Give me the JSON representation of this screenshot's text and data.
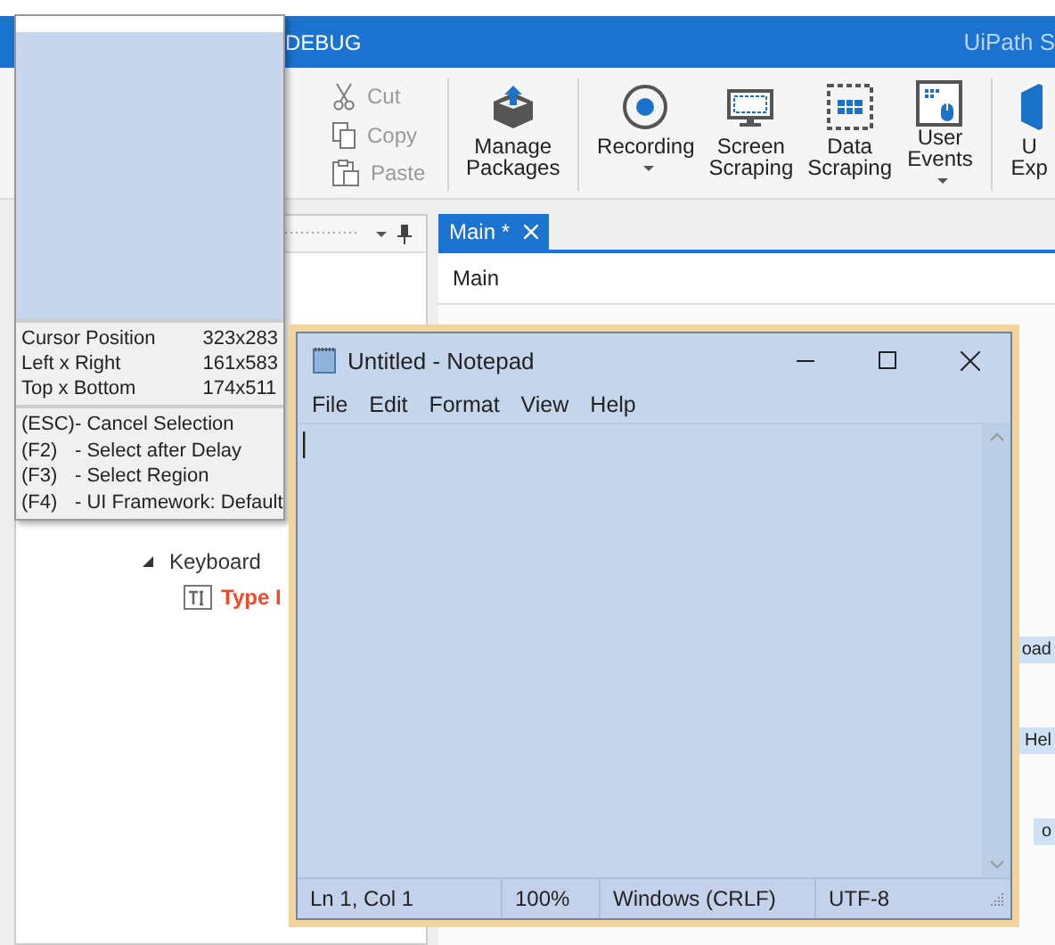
{
  "title_bar": {
    "menu_fragment": "DEBUG",
    "app_title": "UiPath S"
  },
  "ribbon": {
    "clipboard": [
      {
        "label": "Cut",
        "kind": "cut",
        "disabled": true
      },
      {
        "label": "Copy",
        "kind": "copy",
        "disabled": true
      },
      {
        "label": "Paste",
        "kind": "paste",
        "disabled": true
      }
    ],
    "buttons": [
      {
        "lines": [
          "Manage",
          "Packages"
        ],
        "kind": "packages",
        "dropdown": false,
        "group_end": true
      },
      {
        "lines": [
          "Recording"
        ],
        "kind": "recording",
        "dropdown": true,
        "group_end": false
      },
      {
        "lines": [
          "Screen",
          "Scraping"
        ],
        "kind": "screen",
        "dropdown": false,
        "group_end": false
      },
      {
        "lines": [
          "Data",
          "Scraping"
        ],
        "kind": "data",
        "dropdown": false,
        "group_end": false
      },
      {
        "lines": [
          "User",
          "Events"
        ],
        "kind": "events",
        "dropdown": true,
        "group_end": true
      },
      {
        "lines": [
          "U",
          "Exp"
        ],
        "kind": "explorer",
        "dropdown": false,
        "group_end": false
      }
    ]
  },
  "activities_panel": {
    "tree": [
      {
        "label": "Keyboard",
        "expanded": true,
        "children": [
          {
            "label": "Type I",
            "kind": "type-into"
          }
        ]
      }
    ]
  },
  "document_tabs": [
    {
      "label": "Main *",
      "selected": true
    }
  ],
  "breadcrumb": "Main",
  "designer_fragments": [
    "oad",
    "Hel",
    "o"
  ],
  "selector_popup": {
    "info": [
      {
        "label": "Cursor Position",
        "value": "323x283"
      },
      {
        "label": "Left x Right",
        "value": "161x583"
      },
      {
        "label": "Top x Bottom",
        "value": "174x511"
      }
    ],
    "shortcuts": [
      {
        "key": "(ESC)",
        "action": "- Cancel Selection"
      },
      {
        "key": "(F2)",
        "action": "- Select after Delay"
      },
      {
        "key": "(F3)",
        "action": "- Select Region"
      },
      {
        "key": "(F4)",
        "action": "- UI Framework: Default"
      }
    ]
  },
  "notepad": {
    "title": "Untitled - Notepad",
    "menu": [
      "File",
      "Edit",
      "Format",
      "View",
      "Help"
    ],
    "status_bar": [
      "Ln 1, Col 1",
      "100%",
      "Windows (CRLF)",
      "UTF-8"
    ]
  }
}
